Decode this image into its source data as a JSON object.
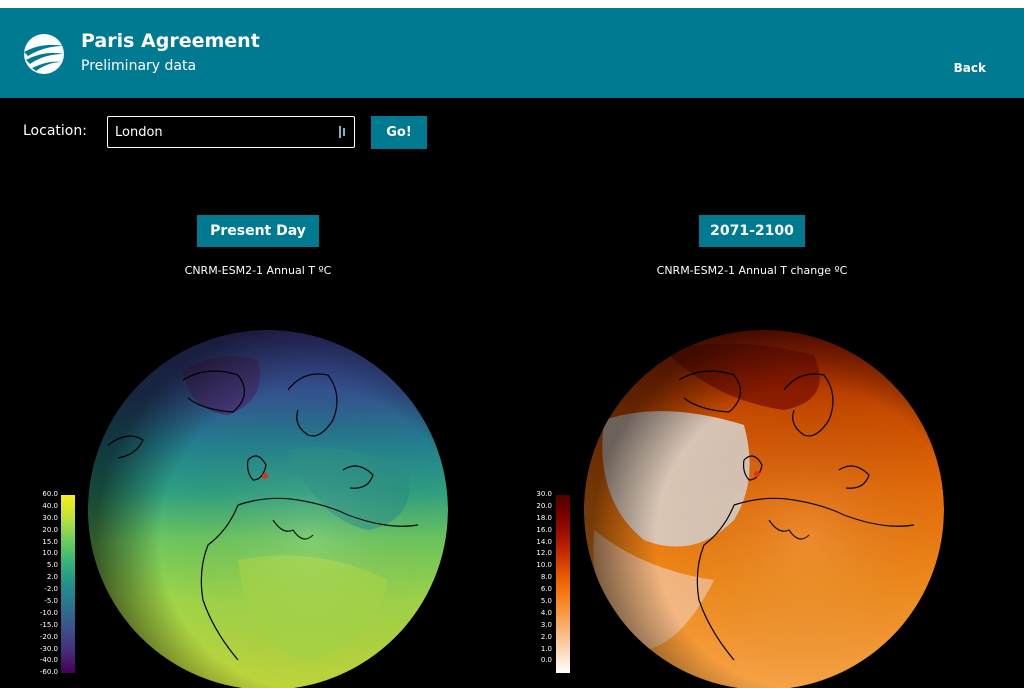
{
  "header": {
    "title": "Paris Agreement",
    "subtitle": "Preliminary data",
    "back_label": "Back",
    "logo_icon": "swoosh-logo-icon"
  },
  "location": {
    "label": "Location:",
    "value": "London",
    "go_label": "Go!"
  },
  "panels": {
    "left": {
      "button_label": "Present Day",
      "caption": "CNRM-ESM2-1 Annual T ºC",
      "colorbar_ticks": [
        "60.0",
        "40.0",
        "30.0",
        "20.0",
        "15.0",
        "10.0",
        "5.0",
        "2.0",
        "-2.0",
        "-5.0",
        "-10.0",
        "-15.0",
        "-20.0",
        "-30.0",
        "-40.0",
        "-60.0"
      ]
    },
    "right": {
      "button_label": "2071-2100",
      "caption": "CNRM-ESM2-1 Annual T change ºC",
      "colorbar_ticks": [
        "30.0",
        "20.0",
        "18.0",
        "16.0",
        "14.0",
        "12.0",
        "10.0",
        "8.0",
        "6.0",
        "5.0",
        "4.0",
        "3.0",
        "2.0",
        "1.0",
        "0.0"
      ]
    }
  },
  "colors": {
    "accent": "#007a90",
    "background": "#000000"
  }
}
